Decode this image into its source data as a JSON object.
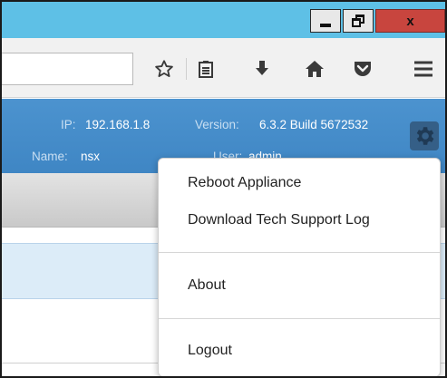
{
  "window": {
    "title_bar_color": "#5ec0e6",
    "close_button_color": "#c8453e",
    "minimize_icon": "minimize-icon",
    "maximize_icon": "restore-icon",
    "close_label": "x"
  },
  "browser_toolbar": {
    "url_value": "",
    "icons": [
      "star-icon",
      "reader-view-icon",
      "download-icon",
      "home-icon",
      "pocket-icon",
      "hamburger-menu-icon"
    ]
  },
  "header": {
    "ip_label": "IP:",
    "ip_value": "192.168.1.8",
    "version_label": "Version:",
    "version_value": "6.3.2 Build 5672532",
    "name_label": "Name:",
    "name_value": "nsx",
    "user_label": "User:",
    "user_value": "admin",
    "settings_icon": "gear-icon",
    "accent_color": "#4c93cf"
  },
  "settings_menu": {
    "items": [
      {
        "label": "Reboot Appliance"
      },
      {
        "label": "Download Tech Support Log"
      },
      {
        "label": "About"
      },
      {
        "label": "Logout"
      }
    ]
  }
}
